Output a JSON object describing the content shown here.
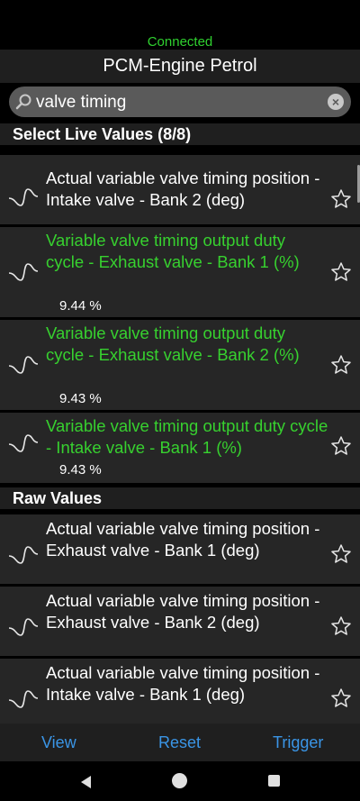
{
  "status": "Connected",
  "title": "PCM-Engine Petrol",
  "search": {
    "value": "valve timing"
  },
  "sections": {
    "live_header": "Select Live Values (8/8)",
    "raw_header": "Raw Values"
  },
  "live_rows": [
    {
      "label": "Actual variable valve timing position  -  Intake valve  -  Bank 2 (deg)",
      "value": ""
    },
    {
      "label": "Variable valve timing output duty cycle  -  Exhaust valve  -  Bank 1 (%)",
      "value": "9.44 %"
    },
    {
      "label": "Variable valve timing output duty cycle  -  Exhaust valve  -  Bank 2 (%)",
      "value": "9.43 %"
    },
    {
      "label": "Variable valve timing output duty cycle  -  Intake valve  -  Bank 1 (%)",
      "value": "9.43 %"
    }
  ],
  "raw_rows": [
    {
      "label": "Actual variable valve timing position  -  Exhaust valve  -  Bank 1 (deg)"
    },
    {
      "label": "Actual variable valve timing position  -  Exhaust valve  -  Bank 2 (deg)"
    },
    {
      "label": "Actual variable valve timing position  -  Intake valve  -  Bank 1 (deg)"
    }
  ],
  "toolbar": {
    "view": "View",
    "reset": "Reset",
    "trigger": "Trigger"
  },
  "colors": {
    "active_green": "#37d12f",
    "accent_blue": "#3a95e6",
    "connected_green": "#2fd12f"
  }
}
